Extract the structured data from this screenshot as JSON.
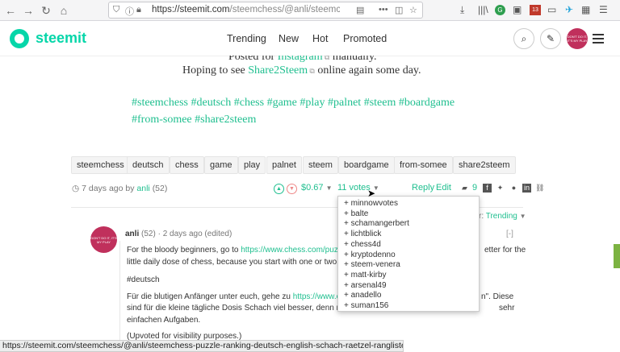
{
  "browser": {
    "url_prefix": "https://steemit.com",
    "url_rest": "/steemchess/@anli/steemche",
    "badge": "13",
    "green_badge": "G"
  },
  "header": {
    "logo_text": "steemit",
    "nav": [
      "Trending",
      "New",
      "Hot",
      "Promoted"
    ],
    "avatar_caption": "DON'T DO IT, IT'S MY PLAY"
  },
  "post": {
    "line1_pre": "Posted for ",
    "line1_link": "Instagram",
    "line1_post": " manually.",
    "line2_pre": "Hoping to see ",
    "line2_link": "Share2Steem",
    "line2_post": " online again some day.",
    "hashtags_line1": "#steemchess #deutsch #chess #game #play #palnet #steem #boardgame",
    "hashtags_line2": "#from-somee #share2steem",
    "tags": [
      "steemchess",
      "deutsch",
      "chess",
      "game",
      "play",
      "palnet",
      "steem",
      "boardgame",
      "from-somee",
      "share2steem"
    ],
    "time": "7 days ago by",
    "author": "anli",
    "rep": "(52)",
    "payout": "$0.67",
    "votes_label": "11 votes",
    "reply": "Reply",
    "edit": "Edit",
    "comments_count": "9"
  },
  "voters": [
    "+ minnowvotes",
    "+ balte",
    "+ schamangerbert",
    "+ lichtblick",
    "+ chess4d",
    "+ kryptodenno",
    "+ steem-venera",
    "+ matt-kirby",
    "+ arsenal49",
    "+ anadello",
    "+ suman156"
  ],
  "sort": {
    "label": "r:",
    "value": "Trending"
  },
  "comment": {
    "author": "anli",
    "rep": "(52)",
    "time": "2 days ago",
    "edited": "(edited)",
    "collapse": "[-]",
    "p1_pre": "For the bloody beginners, go to ",
    "p1_link": "https://www.chess.com/puzzles",
    "p1_tail": "etter for the",
    "p1_line2": "little daily dose of chess, because you start with one or two very",
    "hashtag": "#deutsch",
    "p2_pre": "Für die blutigen Anfänger unter euch, gehe zu ",
    "p2_link": "https://www.chess",
    "p2_tail": "n\". Diese",
    "p2_line2": "sind für die kleine tägliche Dosis Schach viel besser, denn man b",
    "p2_tail2": "sehr",
    "p2_line3": "einfachen Aufgaben.",
    "p3": "(Upvoted for visibility purposes.)"
  },
  "status_url": "https://steemit.com/steemchess/@anli/steemchess-puzzle-ranking-deutsch-english-schach-raetzel-rangliste#",
  "colors": {
    "accent": "#06d6a9",
    "link": "#1fbf8f"
  }
}
